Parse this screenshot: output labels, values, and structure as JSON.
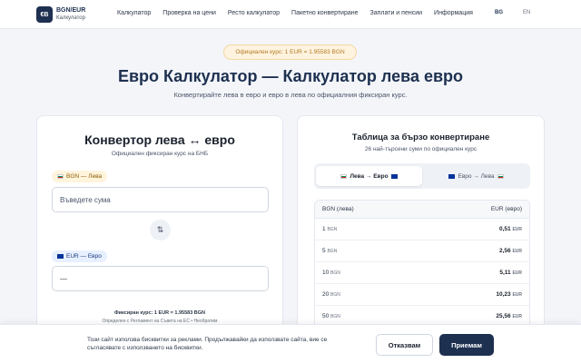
{
  "header": {
    "logo_icon": "euro-bgn-icon",
    "logo_mark": "€B",
    "logo_title": "BGN/EUR",
    "logo_subtitle": "Калкулатор",
    "nav": [
      "Калкулатор",
      "Проверка на цени",
      "Ресто калкулатор",
      "Пакетно конвертиране",
      "Заплати и пенсии",
      "Информация"
    ],
    "lang_bg": "BG",
    "lang_en": "EN"
  },
  "hero": {
    "badge": "Официален курс: 1 EUR = 1.95583 BGN",
    "title": "Евро Калкулатор — Калкулатор лева евро",
    "subtitle": "Конвертирайте лева в евро и евро в лева по официалния фиксиран курс."
  },
  "converter": {
    "title": "Конвертор лева ↔ евро",
    "subtitle": "Официален фиксиран курс на БНБ",
    "from_tag": "BGN — Лева",
    "amount_placeholder": "Въведете сума",
    "swap_icon": "swap-icon",
    "to_tag": "EUR — Евро",
    "result_value": "—",
    "fixed_rate": "Фиксиран курс: 1 EUR = 1.95583 BGN",
    "fixed_note": "Определен с Регламент на Съвета на ЕС • Необратим"
  },
  "quick_table": {
    "title": "Таблица за бързо конвертиране",
    "subtitle": "26 най-търсени суми по официален курс",
    "toggle_1": "Лева → Евро",
    "toggle_2": "Евро → Лева",
    "col_bgn": "BGN (лева)",
    "col_eur": "EUR (евро)",
    "unit_bgn": "BGN",
    "unit_eur": "EUR",
    "rows": [
      {
        "bgn": "1",
        "eur": "0,51"
      },
      {
        "bgn": "5",
        "eur": "2,56"
      },
      {
        "bgn": "10",
        "eur": "5,11"
      },
      {
        "bgn": "20",
        "eur": "10,23"
      },
      {
        "bgn": "50",
        "eur": "25,56"
      }
    ]
  },
  "cookie": {
    "text": "Този сайт използва бисквитки за реклами. Продължавайки да използвате сайта, вие се съгласявате с използването на бисквитки.",
    "decline": "Отказвам",
    "accept": "Приемам"
  }
}
